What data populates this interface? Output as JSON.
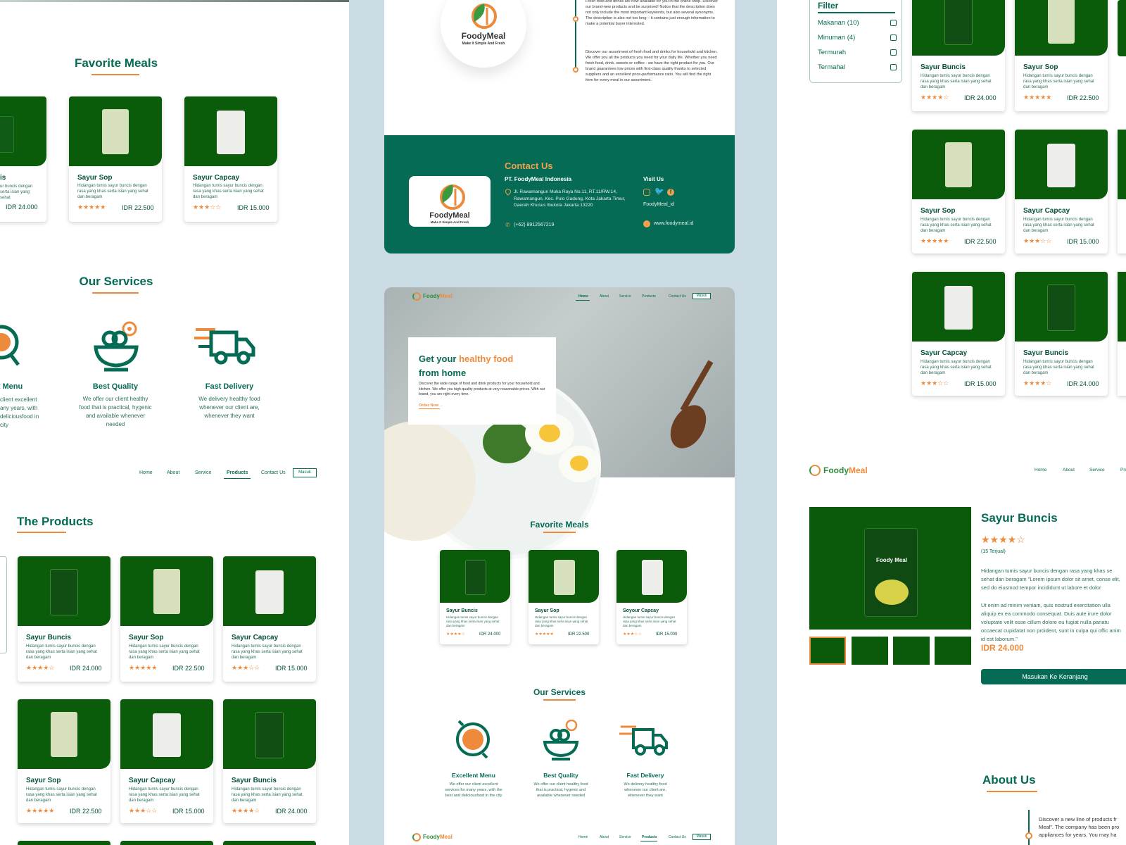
{
  "colors": {
    "primary": "#066b54",
    "accent": "#ee8a3c",
    "card_img": "#0a5c0a",
    "mid_bg": "#cbdbe3"
  },
  "brand": {
    "name": "FoodyMeal",
    "name_part1": "Foody",
    "name_part2": "Meal",
    "tagline": "Make It Simple And Fresh"
  },
  "nav": {
    "home": "Home",
    "about": "About",
    "service": "Service",
    "products": "Products",
    "contact": "Contact Us",
    "login": "Masuk"
  },
  "sections": {
    "favorite": "Favorite Meals",
    "services": "Our Services",
    "products": "The Products",
    "about": "About Us",
    "contact": "Contact Us"
  },
  "meals": {
    "buncis": {
      "name": "Sayur Buncis",
      "desc": "Hidangan tumis sayur buncis dengan rasa yang khas serta isian yang sehat dan beragam",
      "stars": "★★★★☆",
      "price": "IDR 24.000"
    },
    "sop": {
      "name": "Sayur Sop",
      "desc": "Hidangan tumis sayur buncis dengan rasa yang khas serta isian yang sehat dan beragam",
      "stars": "★★★★★",
      "price": "IDR 22.500"
    },
    "capcay": {
      "name": "Sayur Capcay",
      "desc": "Hidangan tumis sayur buncis dengan rasa yang khas serta isian yang sehat dan beragam",
      "stars": "★★★☆☆",
      "price": "IDR 15.000"
    },
    "soyour_capcay": "Soyour Capcay",
    "fav_partial_desc": "ur buncis dengan serta isian yang sehat",
    "fav_partial_name": "is"
  },
  "services": {
    "excellent": {
      "name": "Excellent Menu",
      "desc": "We offer our client excellent services for many years, with the best and deliciousfood in the city",
      "partial_name": "nt Menu",
      "partial_desc": [
        "client excellent",
        "any years, with",
        "deliciousfood in",
        "city"
      ]
    },
    "quality": {
      "name": "Best Quality",
      "desc": "We offer our client healthy food that is practical, hygenic and available whenever needed"
    },
    "delivery": {
      "name": "Fast Delivery",
      "desc": "We delivery healthy food whenever our client are, whenever they want"
    }
  },
  "about_text": {
    "p1": "Fresh food and drinks are now available for you in the online shop. Discover our brand-new products and be surprised! Notice that the description does not only include the most important keywords, but also several synonyms. The description is also not too long – it contains just enough information to make a potential buyer interested.",
    "p2": "Discover our assortment of fresh food and drinks for household and kitchen. We offer you all the products you need for your daily life. Whether you need fresh food, drink, sweets or coffee - we have the right product for you. Our brand guarantees low prices with first-class quality thanks to selected suppliers and an excellent price-performance ratio. You will find the right item for every meal in our assortment.",
    "right": "Discover a new line of products fr Meal\". The company has been pro appliances for years. You may ha"
  },
  "contact": {
    "company": "PT. FoodyMeal Indonesia",
    "address": "Jl. Rawamangun Muka Raya No.11, RT.11/RW.14, Rawamangun, Kec. Pulo Gadung, Kota Jakarta Timur, Daerah Khusus Ibukota Jakarta 13220",
    "phone": "(+62) 8912567219",
    "visit": "Visit Us",
    "social": "FoodyMeal_id",
    "web": "www.foodymeal.id"
  },
  "hero": {
    "l1a": "Get your ",
    "l1b": "healthy food",
    "l2": "from home",
    "body": "Discover the wide range of food and drink products for your household and kitchen. We offer you high-quality products at very reasonable prices. With our brand, you are right every time.",
    "cta": "Order Now"
  },
  "filter": {
    "title": "Filter",
    "items": [
      "Makanan (10)",
      "Minuman (4)",
      "Termurah",
      "Termahal"
    ]
  },
  "detail": {
    "name": "Sayur Buncis",
    "stars": "★★★★☆",
    "sold": "(15 Terjual)",
    "p1": "Hidangan tumis sayur buncis dengan rasa yang khas se sehat dan beragam \"Lorem ipsum dolor sit amet, conse elit, sed do eiusmod tempor incididunt ut labore et dolor",
    "p2": "Ut enim ad minim veniam, quis nostrud exercitation ulla aliquip ex ea commodo consequat. Duis aute irure dolor voluptate velit esse cillum dolore eu fugiat nulla pariatu occaecat cupidatat non proident, sunt in culpa qui offic anim id est laborum.\"",
    "price": "IDR 24.000",
    "cart": "Masukan Ke Keranjang",
    "pack_title": "Foody Meal"
  }
}
